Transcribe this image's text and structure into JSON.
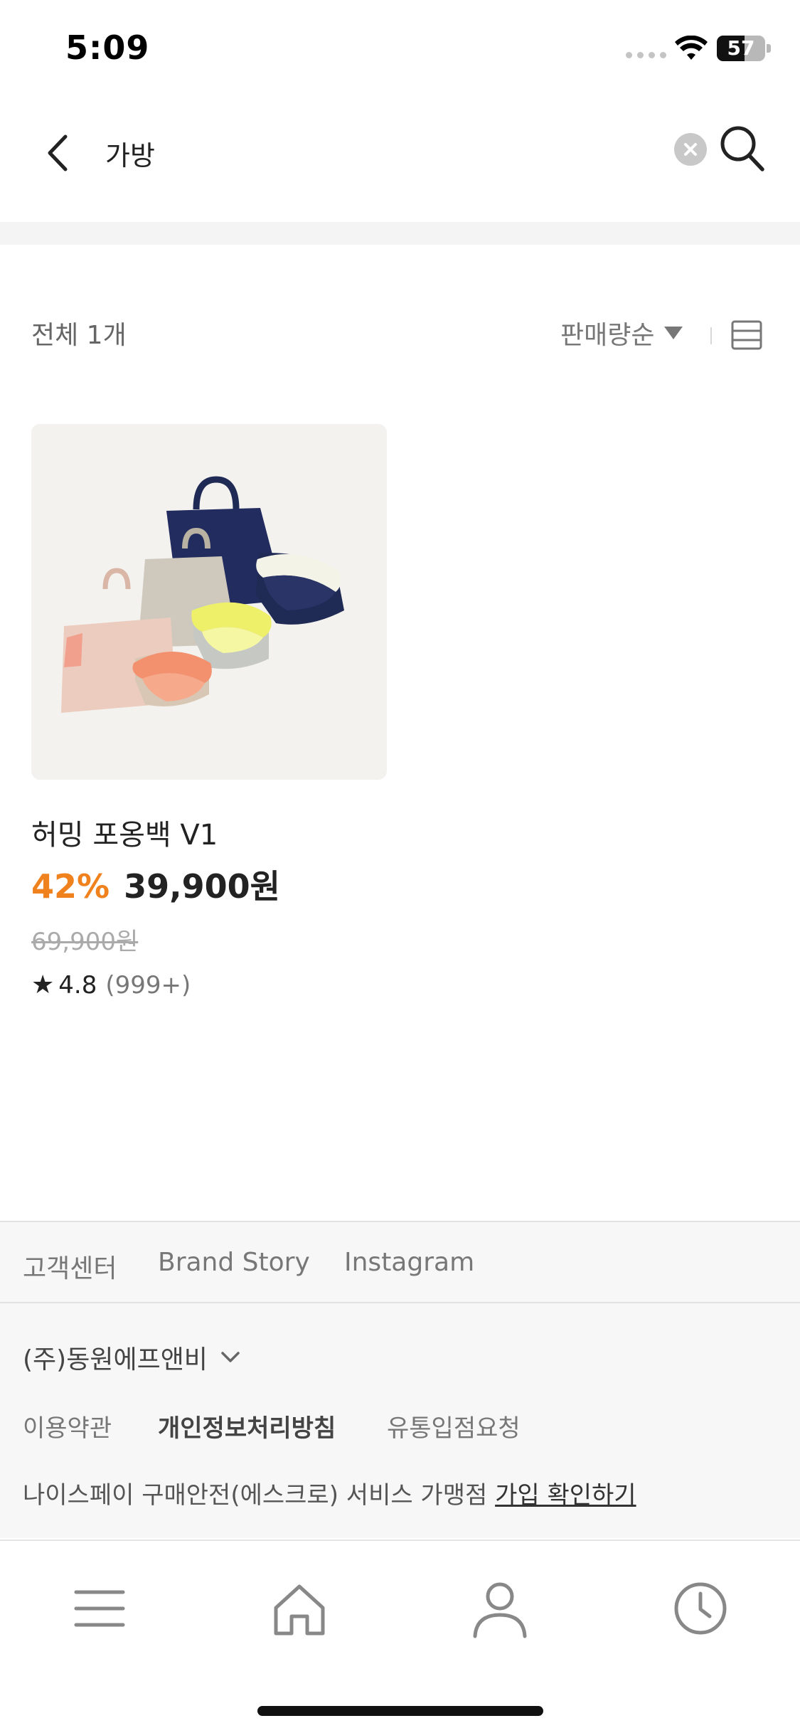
{
  "status_bar": {
    "time": "5:09",
    "battery_level": "57",
    "icons": [
      "signal-dots-icon",
      "wifi-icon",
      "battery-icon"
    ]
  },
  "search": {
    "query": "가방",
    "icons": [
      "back-chevron-icon",
      "clear-circle-icon",
      "search-magnifier-icon"
    ]
  },
  "list_header": {
    "total_label": "전체 1개",
    "sort_label": "판매량순",
    "icons": [
      "caret-down-icon",
      "list-view-icon"
    ]
  },
  "products": [
    {
      "name": "허밍 포옹백 V1",
      "discount": "42%",
      "price": "39,900원",
      "original_price": "69,900원",
      "rating": "4.8",
      "review_count": "(999+)",
      "image": "pet carrier bags in pink, beige, navy with yellow, coral and white cushions"
    }
  ],
  "footer": {
    "links": [
      "고객센터",
      "Brand Story",
      "Instagram"
    ],
    "company": "(주)동원에프앤비",
    "policies": [
      "이용약관",
      "개인정보처리방침",
      "유통입점요청"
    ],
    "escrow_text": "나이스페이 구매안전(에스크로) 서비스 가맹점",
    "escrow_link": "가입 확인하기"
  },
  "bottom_nav": {
    "icons": [
      "menu-icon",
      "home-icon",
      "user-icon",
      "clock-icon"
    ]
  },
  "colors": {
    "accent_discount": "#f0821e",
    "text_primary": "#222222",
    "text_secondary": "#777777",
    "background_band": "#f4f4f4"
  }
}
